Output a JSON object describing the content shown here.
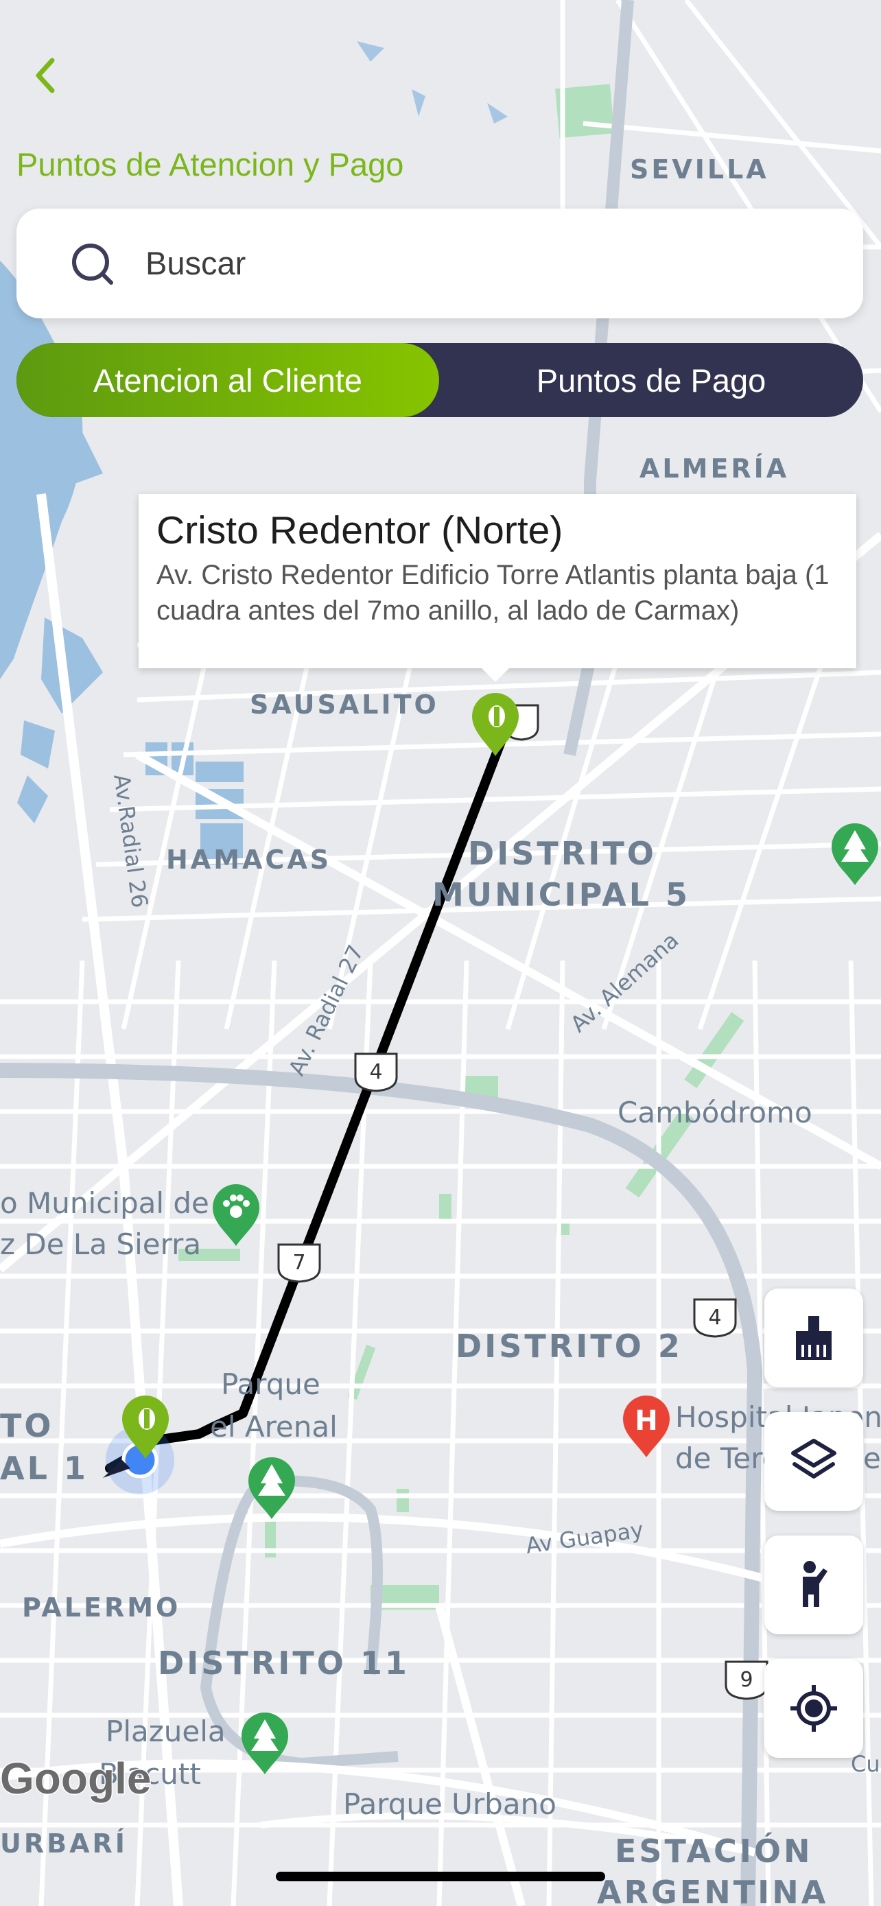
{
  "header": {
    "back_icon": "chevron-left-icon",
    "title": "Puntos de Atencion y Pago"
  },
  "search": {
    "icon": "search-icon",
    "placeholder": "Buscar"
  },
  "tabs": [
    {
      "label": "Atencion al Cliente",
      "selected": true
    },
    {
      "label": "Puntos de Pago",
      "selected": false
    }
  ],
  "info_window": {
    "title": "Cristo Redentor (Norte)",
    "address": "Av. Cristo Redentor Edificio Torre Atlantis  planta baja (1 cuadra antes del 7mo anillo, al lado de Carmax)"
  },
  "map": {
    "areas": {
      "sevilla": "SEVILLA",
      "almeria": "ALMERÍA",
      "sausalito": "SAUSALITO",
      "hamacas": "HAMACAS",
      "distrito_municipal_5_line1": "DISTRITO",
      "distrito_municipal_5_line2": "MUNICIPAL 5",
      "distrito_2": "DISTRITO 2",
      "distrito_11": "DISTRITO 11",
      "palermo": "PALERMO",
      "urbari": "URBARÍ",
      "estacion_line1": "ESTACIÓN",
      "estacion_line2": "ARGENTINA",
      "left_cut_line1": "TO",
      "left_cut_line2": "AL 1"
    },
    "places": {
      "cambodromo": "Cambódromo",
      "zoo_line1": "o Municipal de",
      "zoo_line2": "z De La Sierra",
      "parque_arenal_line1": "Parque",
      "parque_arenal_line2": "el Arenal",
      "hospital_line1": "Hospital Japon",
      "hospital_line2": "de Tercer Nive",
      "plazuela_line1": "Plazuela",
      "plazuela_line2": "Blacutt",
      "parque_urbano": "Parque Urbano",
      "cur": "Cur"
    },
    "streets": {
      "av_radial_26": "Av.Radial 26",
      "av_radial_27": "Av. Radial 27",
      "av_alemana": "Av. Alemana",
      "av_guapay": "Av Guapay"
    },
    "route_shields": [
      "4",
      "7",
      "4",
      "9"
    ],
    "attribution": "Google",
    "colors": {
      "route": "#000000",
      "water": "#9cc0df",
      "park": "#b2dfbd",
      "marker_green": "#7bb71b",
      "poi_green": "#34a853",
      "hospital_red": "#ea4335",
      "user_location": "#4285f4"
    }
  },
  "map_controls": [
    {
      "name": "clear-map-button",
      "icon": "broom-icon"
    },
    {
      "name": "layers-button",
      "icon": "layers-icon"
    },
    {
      "name": "street-view-button",
      "icon": "pegman-icon"
    },
    {
      "name": "my-location-button",
      "icon": "crosshair-icon"
    }
  ]
}
